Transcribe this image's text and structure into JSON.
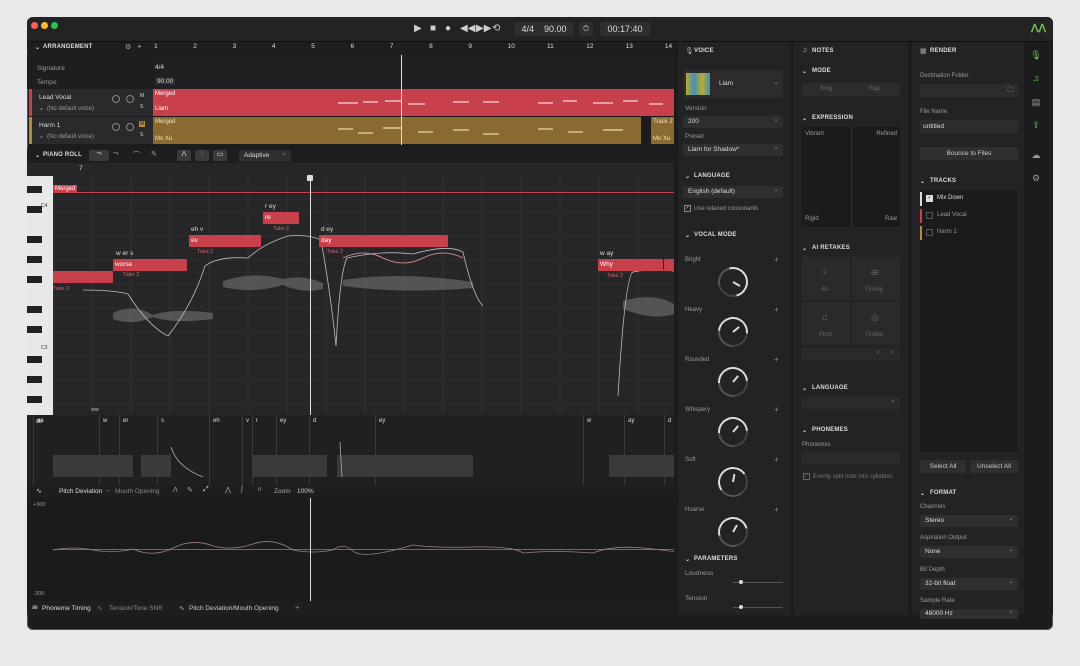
{
  "transport": {
    "meter": "4/4",
    "tempo": "90.00",
    "time": "00:17:40"
  },
  "arrangement": {
    "title": "ARRANGEMENT",
    "ruler": [
      "1",
      "2",
      "3",
      "4",
      "5",
      "6",
      "7",
      "8",
      "9",
      "10",
      "11",
      "12",
      "13",
      "14"
    ],
    "signature_label": "Signature",
    "signature": "4/4",
    "tempo_label": "Tempo",
    "tempo": "90.00",
    "tracks": [
      {
        "name": "Lead Vocal",
        "voice": "(No default voice)",
        "clip": "Merged",
        "clip2": "Liam",
        "m": "M",
        "s": "S"
      },
      {
        "name": "Harm 1",
        "voice": "(No default voice)",
        "clip": "Merged",
        "clip2": "Mo Xu",
        "clip3": "Track 2",
        "clip4": "Mo Xu",
        "m": "M",
        "s": "S"
      }
    ]
  },
  "piano_roll": {
    "title": "PIANO ROLL",
    "mode": "Adaptive",
    "bar": "7",
    "region": "Merged",
    "keys": [
      "C4",
      "C3"
    ],
    "notes": [
      {
        "lyric": "worse",
        "phon": "w er s",
        "take": "Take 2"
      },
      {
        "lyric": "ev",
        "phon": "eh v",
        "take": "Take 2"
      },
      {
        "lyric": "re",
        "phon": "r ey",
        "take": "Take 2"
      },
      {
        "lyric": "day",
        "phon": "d ey",
        "take": "Take 2"
      },
      {
        "lyric": "Why",
        "phon": "w ay",
        "take": "Take 2"
      },
      {
        "lyric": "",
        "phon": "",
        "take": "Take 2"
      }
    ]
  },
  "phonemes": [
    "aa",
    "w",
    "er",
    "s",
    "eh",
    "v",
    "r",
    "ey",
    "d",
    "ey",
    "w",
    "ay",
    "d"
  ],
  "param_bar": {
    "active": "Pitch Deviation",
    "second": "Mouth Opening",
    "zoom_label": "Zoom",
    "zoom": "100%",
    "top": "+300",
    "bottom": "-300"
  },
  "bottom_tabs": [
    "Phoneme Timing",
    "Tension/Tone Shift",
    "Pitch Deviation/Mouth Opening"
  ],
  "voice": {
    "title": "VOICE",
    "name": "Liam",
    "version_label": "Version",
    "version": "200",
    "preset_label": "Preset",
    "preset": "Liam for Shadow*",
    "language_title": "LANGUAGE",
    "language": "English (default)",
    "relaxed": "Use relaxed consonants",
    "vocal_mode_title": "VOCAL MODE",
    "modes": [
      "Bright",
      "Heavy",
      "Rounded",
      "Whispery",
      "Soft",
      "Hoarse"
    ],
    "parameters_title": "PARAMETERS",
    "params": [
      "Loudness",
      "Tension"
    ]
  },
  "notes_panel": {
    "title": "NOTES",
    "mode_title": "MODE",
    "mode_a": "Sing",
    "mode_b": "Rap",
    "expression_title": "EXPRESSION",
    "expr_tl": "Vibrant",
    "expr_tr": "Refined",
    "expr_bl": "Rigid",
    "expr_br": "Raw",
    "retakes_title": "AI RETAKES",
    "retakes": [
      "All",
      "Timing",
      "Pitch",
      "Timbre"
    ],
    "language_title": "LANGUAGE",
    "phonemes_title": "PHONEMES",
    "phonemes_label": "Phonemes",
    "split": "Evenly split note into syllables"
  },
  "render": {
    "title": "RENDER",
    "dest_label": "Destination Folder",
    "file_label": "File Name",
    "file": "untitled",
    "bounce": "Bounce to Files",
    "tracks_title": "TRACKS",
    "tracks": [
      "Mix Down",
      "Lead Vocal",
      "Harm 1"
    ],
    "select_all": "Select All",
    "unselect_all": "Unselect All",
    "format_title": "FORMAT",
    "channels_label": "Channels",
    "channels": "Stereo",
    "aspiration_label": "Aspiration Output",
    "aspiration": "None",
    "bitdepth_label": "Bit Depth",
    "bitdepth": "32-bit float",
    "samplerate_label": "Sample Rate",
    "samplerate": "48000 Hz"
  },
  "colors": {
    "accent": "#c8404c",
    "harm": "#b58a3c",
    "green": "#6ec24a"
  }
}
